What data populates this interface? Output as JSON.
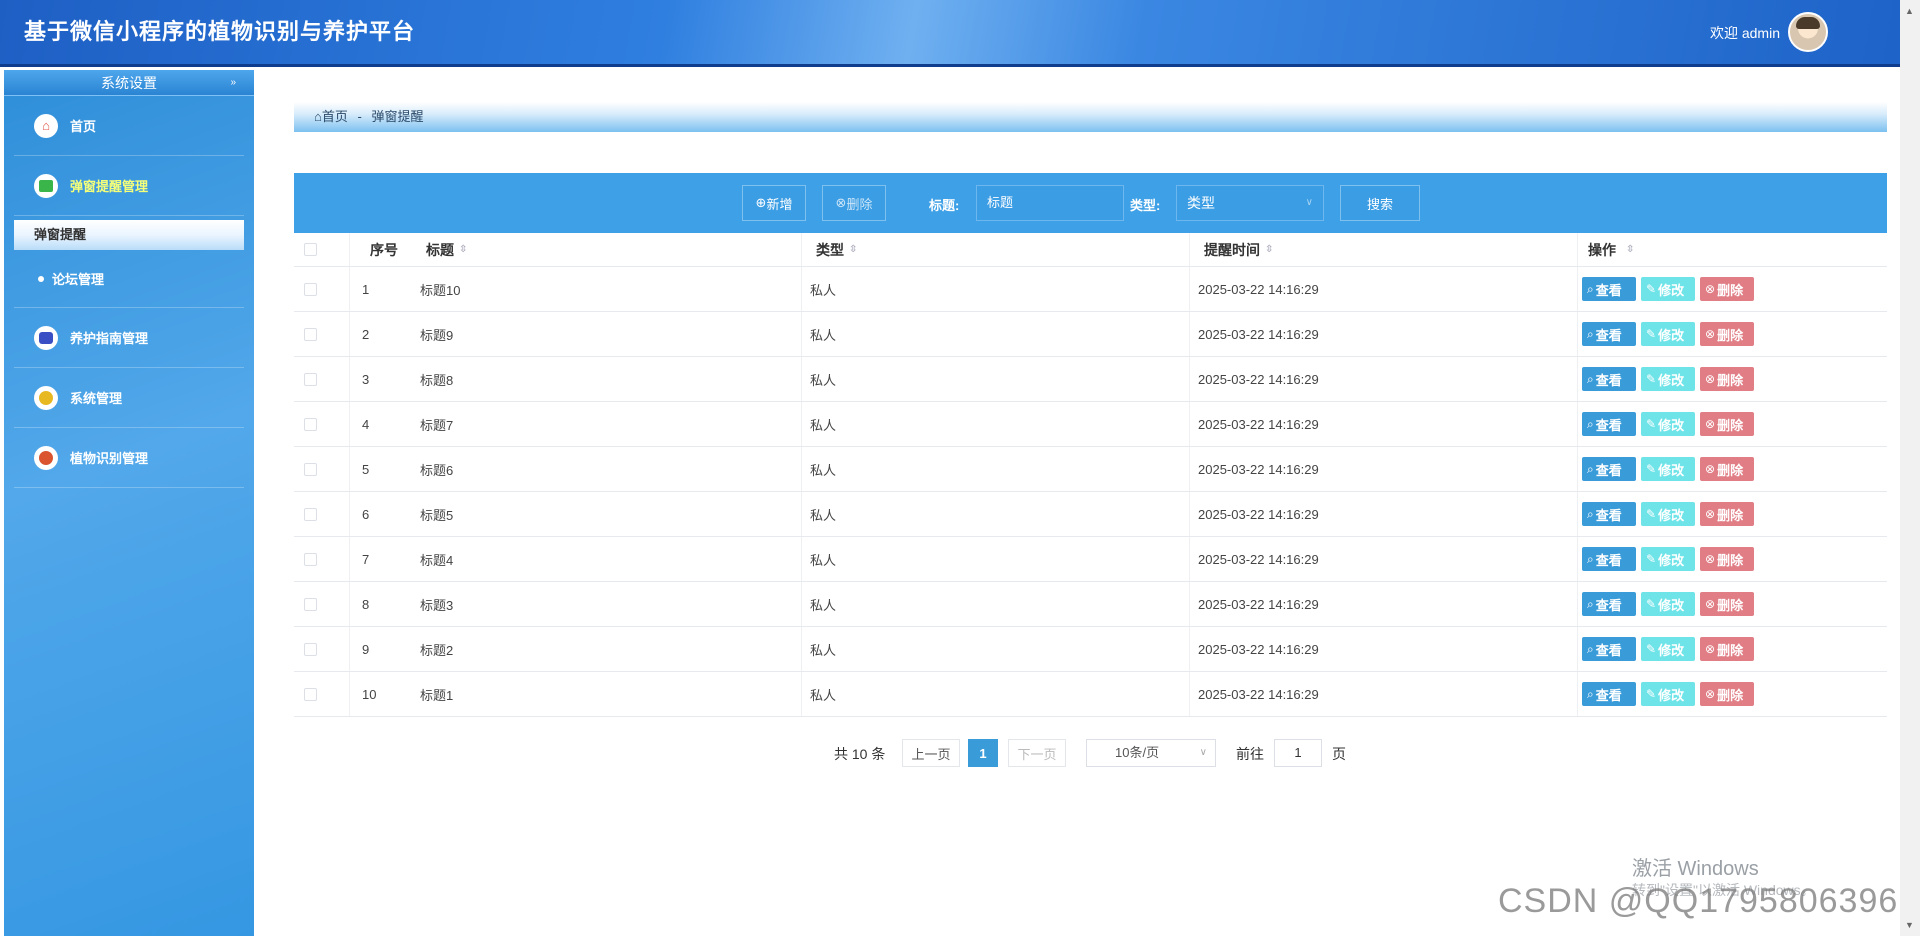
{
  "header": {
    "title": "基于微信小程序的植物识别与养护平台",
    "welcome": "欢迎 admin"
  },
  "sidebar": {
    "section_title": "系统设置",
    "items": [
      {
        "label": "首页",
        "icon": "home-icon"
      },
      {
        "label": "弹窗提醒管理",
        "icon": "shirt-icon",
        "active": true
      },
      {
        "label": "弹窗提醒",
        "sub": true,
        "selected": true
      },
      {
        "label": "论坛管理",
        "sub": true
      },
      {
        "label": "养护指南管理",
        "icon": "robot-icon"
      },
      {
        "label": "系统管理",
        "icon": "coin-icon"
      },
      {
        "label": "植物识别管理",
        "icon": "face-icon"
      }
    ]
  },
  "breadcrumb": {
    "home": "首页",
    "separator": "-",
    "current": "弹窗提醒"
  },
  "toolbar": {
    "add_label": "新增",
    "delete_label": "删除",
    "title_label": "标题:",
    "title_placeholder": "标题",
    "type_label": "类型:",
    "type_placeholder": "类型",
    "search_label": "搜索"
  },
  "table": {
    "headers": {
      "index": "序号",
      "title": "标题",
      "type": "类型",
      "time": "提醒时间",
      "ops": "操作"
    },
    "op_labels": {
      "view": "查看",
      "edit": "修改",
      "delete": "删除"
    },
    "rows": [
      {
        "index": "1",
        "title": "标题10",
        "type": "私人",
        "time": "2025-03-22 14:16:29"
      },
      {
        "index": "2",
        "title": "标题9",
        "type": "私人",
        "time": "2025-03-22 14:16:29"
      },
      {
        "index": "3",
        "title": "标题8",
        "type": "私人",
        "time": "2025-03-22 14:16:29"
      },
      {
        "index": "4",
        "title": "标题7",
        "type": "私人",
        "time": "2025-03-22 14:16:29"
      },
      {
        "index": "5",
        "title": "标题6",
        "type": "私人",
        "time": "2025-03-22 14:16:29"
      },
      {
        "index": "6",
        "title": "标题5",
        "type": "私人",
        "time": "2025-03-22 14:16:29"
      },
      {
        "index": "7",
        "title": "标题4",
        "type": "私人",
        "time": "2025-03-22 14:16:29"
      },
      {
        "index": "8",
        "title": "标题3",
        "type": "私人",
        "time": "2025-03-22 14:16:29"
      },
      {
        "index": "9",
        "title": "标题2",
        "type": "私人",
        "time": "2025-03-22 14:16:29"
      },
      {
        "index": "10",
        "title": "标题1",
        "type": "私人",
        "time": "2025-03-22 14:16:29"
      }
    ]
  },
  "pagination": {
    "total": "共 10 条",
    "prev": "上一页",
    "current": "1",
    "next": "下一页",
    "page_size": "10条/页",
    "goto": "前往",
    "goto_value": "1",
    "page_unit": "页"
  },
  "watermark": {
    "windows_line1": "激活 Windows",
    "windows_line2": "转到\"设置\"以激活 Windows。",
    "csdn": "CSDN @QQ1795806396"
  },
  "colors": {
    "header": "#2f7fe0",
    "sidebar": "#3f9de4",
    "toolbar": "#3ea0e6",
    "view": "#3a9bd9",
    "edit": "#6ee3e8",
    "delete": "#e07d85"
  }
}
